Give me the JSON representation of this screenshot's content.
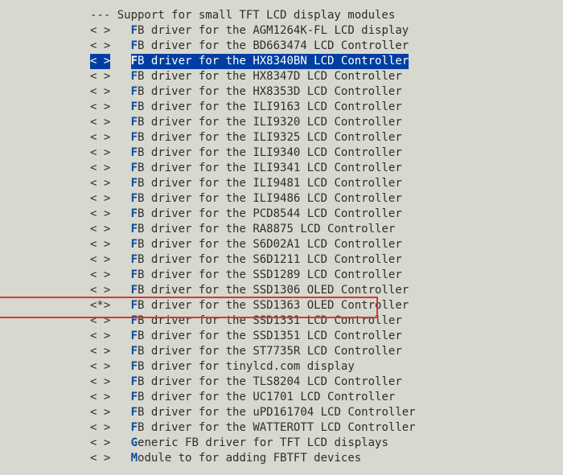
{
  "section_header": "--- Support for small TFT LCD display modules",
  "colors": {
    "bg": "#d7d8cf",
    "fg": "#2e2e2e",
    "hotkey": "#0b4d9b",
    "cursor_bg": "#003ea3",
    "cursor_fg": "#ffffff",
    "highlight_border": "#d9392e"
  },
  "items": [
    {
      "state": "< >",
      "hotkey": "F",
      "label": "B driver for the AGM1264K-FL LCD display"
    },
    {
      "state": "< >",
      "hotkey": "F",
      "label": "B driver for the BD663474 LCD Controller"
    },
    {
      "state": "< >",
      "hotkey": "F",
      "label": "B driver for the HX8340BN LCD Controller",
      "cursor": true
    },
    {
      "state": "< >",
      "hotkey": "F",
      "label": "B driver for the HX8347D LCD Controller"
    },
    {
      "state": "< >",
      "hotkey": "F",
      "label": "B driver for the HX8353D LCD Controller"
    },
    {
      "state": "< >",
      "hotkey": "F",
      "label": "B driver for the ILI9163 LCD Controller"
    },
    {
      "state": "< >",
      "hotkey": "F",
      "label": "B driver for the ILI9320 LCD Controller"
    },
    {
      "state": "< >",
      "hotkey": "F",
      "label": "B driver for the ILI9325 LCD Controller"
    },
    {
      "state": "< >",
      "hotkey": "F",
      "label": "B driver for the ILI9340 LCD Controller"
    },
    {
      "state": "< >",
      "hotkey": "F",
      "label": "B driver for the ILI9341 LCD Controller"
    },
    {
      "state": "< >",
      "hotkey": "F",
      "label": "B driver for the ILI9481 LCD Controller"
    },
    {
      "state": "< >",
      "hotkey": "F",
      "label": "B driver for the ILI9486 LCD Controller"
    },
    {
      "state": "< >",
      "hotkey": "F",
      "label": "B driver for the PCD8544 LCD Controller"
    },
    {
      "state": "< >",
      "hotkey": "F",
      "label": "B driver for the RA8875 LCD Controller"
    },
    {
      "state": "< >",
      "hotkey": "F",
      "label": "B driver for the S6D02A1 LCD Controller"
    },
    {
      "state": "< >",
      "hotkey": "F",
      "label": "B driver for the S6D1211 LCD Controller"
    },
    {
      "state": "< >",
      "hotkey": "F",
      "label": "B driver for the SSD1289 LCD Controller"
    },
    {
      "state": "< >",
      "hotkey": "F",
      "label": "B driver for the SSD1306 OLED Controller"
    },
    {
      "state": "<*>",
      "hotkey": "F",
      "label": "B driver for the SSD1363 OLED Controller",
      "highlight_box": true
    },
    {
      "state": "< >",
      "hotkey": "F",
      "label": "B driver for the SSD1331 LCD Controller"
    },
    {
      "state": "< >",
      "hotkey": "F",
      "label": "B driver for the SSD1351 LCD Controller"
    },
    {
      "state": "< >",
      "hotkey": "F",
      "label": "B driver for the ST7735R LCD Controller"
    },
    {
      "state": "< >",
      "hotkey": "F",
      "label": "B driver for tinylcd.com display"
    },
    {
      "state": "< >",
      "hotkey": "F",
      "label": "B driver for the TLS8204 LCD Controller"
    },
    {
      "state": "< >",
      "hotkey": "F",
      "label": "B driver for the UC1701 LCD Controller"
    },
    {
      "state": "< >",
      "hotkey": "F",
      "label": "B driver for the uPD161704 LCD Controller"
    },
    {
      "state": "< >",
      "hotkey": "F",
      "label": "B driver for the WATTEROTT LCD Controller"
    },
    {
      "state": "< >",
      "hotkey": "G",
      "label": "eneric FB driver for TFT LCD displays"
    },
    {
      "state": "< >",
      "hotkey": "M",
      "label": "odule to for adding FBTFT devices"
    }
  ]
}
